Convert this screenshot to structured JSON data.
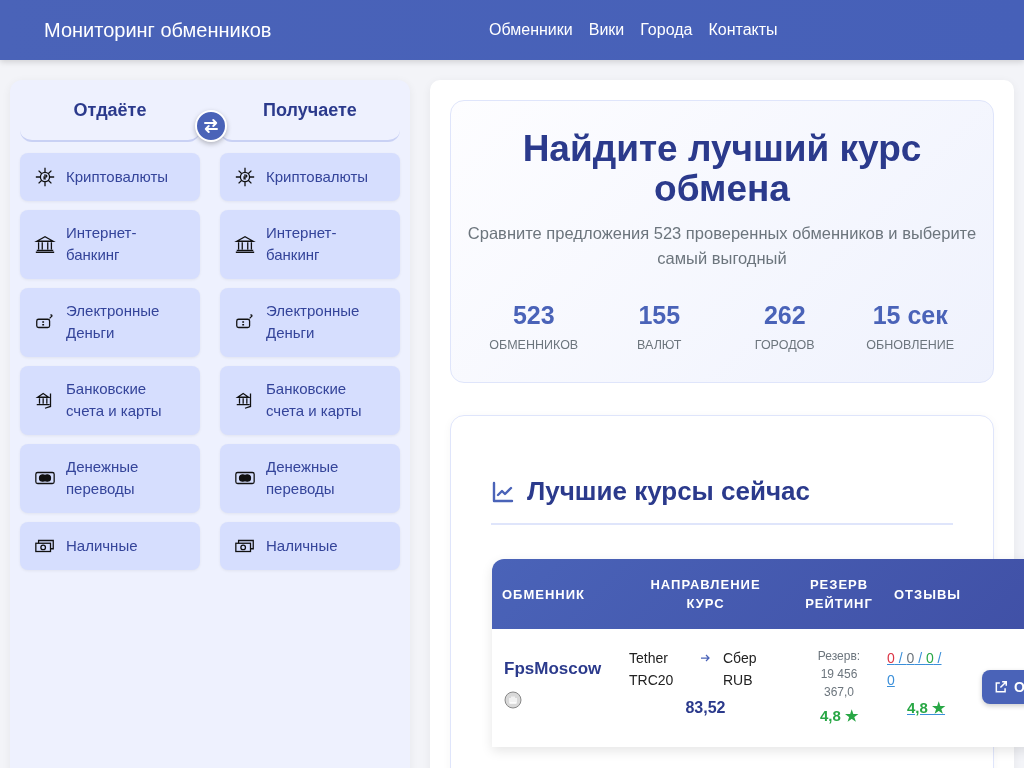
{
  "header": {
    "brand": "Мониторинг обменников",
    "nav": [
      {
        "label": "Обменники"
      },
      {
        "label": "Вики"
      },
      {
        "label": "Города"
      },
      {
        "label": "Контакты"
      }
    ]
  },
  "exchange_panel": {
    "give_title": "Отдаёте",
    "get_title": "Получаете",
    "give": [
      {
        "kind": "crypto",
        "label": "Криптовалюты",
        "selected": false
      },
      {
        "kind": "bank",
        "label": "Интернет-банкинг",
        "selected": false
      },
      {
        "kind": "emoney",
        "label": "Электронные Деньги",
        "selected": false
      },
      {
        "kind": "account",
        "label": "Банковские счета и карты",
        "selected": false
      },
      {
        "kind": "transfer",
        "label": "Денежные переводы",
        "selected": false
      },
      {
        "kind": "cash",
        "label": "Наличные",
        "selected": false
      }
    ],
    "get": [
      {
        "kind": "crypto",
        "label": "Криптовалюты",
        "selected": false
      },
      {
        "kind": "bank",
        "label": "Интернет-банкинг",
        "selected": false
      },
      {
        "kind": "emoney",
        "label": "Электронные Деньги",
        "selected": false
      },
      {
        "kind": "account",
        "label": "Банковские счета и карты",
        "selected": false
      },
      {
        "kind": "transfer",
        "label": "Денежные переводы",
        "selected": false
      },
      {
        "kind": "cash",
        "label": "Наличные",
        "selected": false
      }
    ]
  },
  "hero": {
    "title": "Найдите лучший курс обмена",
    "subtitle": "Сравните предложения 523 проверенных обменников и выберите самый выгодный",
    "stats": [
      {
        "value": "523",
        "label": "ОБМЕННИКОВ"
      },
      {
        "value": "155",
        "label": "ВАЛЮТ"
      },
      {
        "value": "262",
        "label": "ГОРОДОВ"
      },
      {
        "value": "15 сек",
        "label": "ОБНОВЛЕНИЕ"
      }
    ]
  },
  "best_rates": {
    "title": "Лучшие курсы сейчас",
    "columns": [
      {
        "lines": [
          "ОБМЕННИК"
        ]
      },
      {
        "lines": [
          "НАПРАВЛЕНИЕ",
          "КУРС"
        ]
      },
      {
        "lines": [
          "РЕЗЕРВ",
          "РЕЙТИНГ"
        ]
      },
      {
        "lines": [
          "ОТЗЫВЫ"
        ]
      }
    ],
    "rows": [
      {
        "name": "FpsMoscow",
        "from": "Tether TRC20",
        "to": "Сбер RUB",
        "rate": "83,52",
        "reserve_label": "Резерв:",
        "reserve": "19 456 367,0",
        "rating": "4,8 ★",
        "reviews": {
          "separator": "/",
          "counts": [
            {
              "count": "0",
              "color": "#dc3545"
            },
            {
              "count": "0",
              "color": "#6c757d"
            },
            {
              "count": "0",
              "color": "#28a745"
            },
            {
              "count": "0",
              "color": "#3b8fd9"
            }
          ]
        },
        "review_rating": "4,8 ★",
        "button": "О"
      }
    ]
  }
}
